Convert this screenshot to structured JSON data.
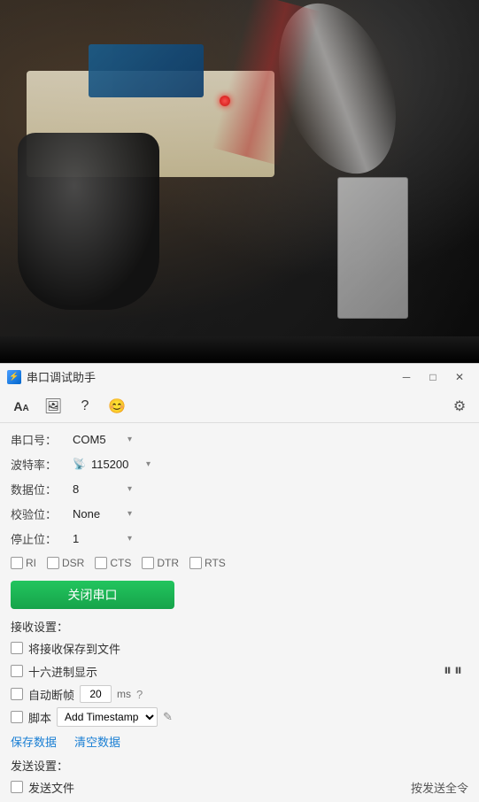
{
  "titlebar": {
    "title": "串口调试助手",
    "min_btn": "─",
    "max_btn": "□",
    "close_btn": "✕"
  },
  "toolbar": {
    "btn1_icon": "AA",
    "btn2_icon": "📷",
    "btn3_icon": "?",
    "btn4_icon": "😊",
    "gear_icon": "⚙"
  },
  "settings": {
    "port_label": "串口号：",
    "port_value": "COM5",
    "baud_label": "波特率：",
    "baud_value": "115200",
    "data_label": "数据位：",
    "data_value": "8",
    "parity_label": "校验位：",
    "parity_value": "None",
    "stop_label": "停止位：",
    "stop_value": "1"
  },
  "signals": {
    "ri_label": "RI",
    "dsr_label": "DSR",
    "cts_label": "CTS",
    "dtr_label": "DTR",
    "rts_label": "RTS"
  },
  "close_port_btn": "关闭串口",
  "receive": {
    "section_label": "接收设置：",
    "save_to_file_label": "将接收保存到文件",
    "hex_display_label": "十六进制显示",
    "autofeed_label": "自动断帧",
    "autofeed_value": "20",
    "autofeed_unit": "ms",
    "question": "?",
    "script_label": "脚本",
    "script_placeholder": "Add Timestamp",
    "edit_icon": "✎",
    "save_data_label": "保存数据",
    "clear_data_label": "清空数据",
    "hex_icons": "⏸⏸"
  },
  "transmit": {
    "section_label": "发送设置：",
    "send_file_label": "发送文件",
    "send_file_value": "按发送全令"
  }
}
